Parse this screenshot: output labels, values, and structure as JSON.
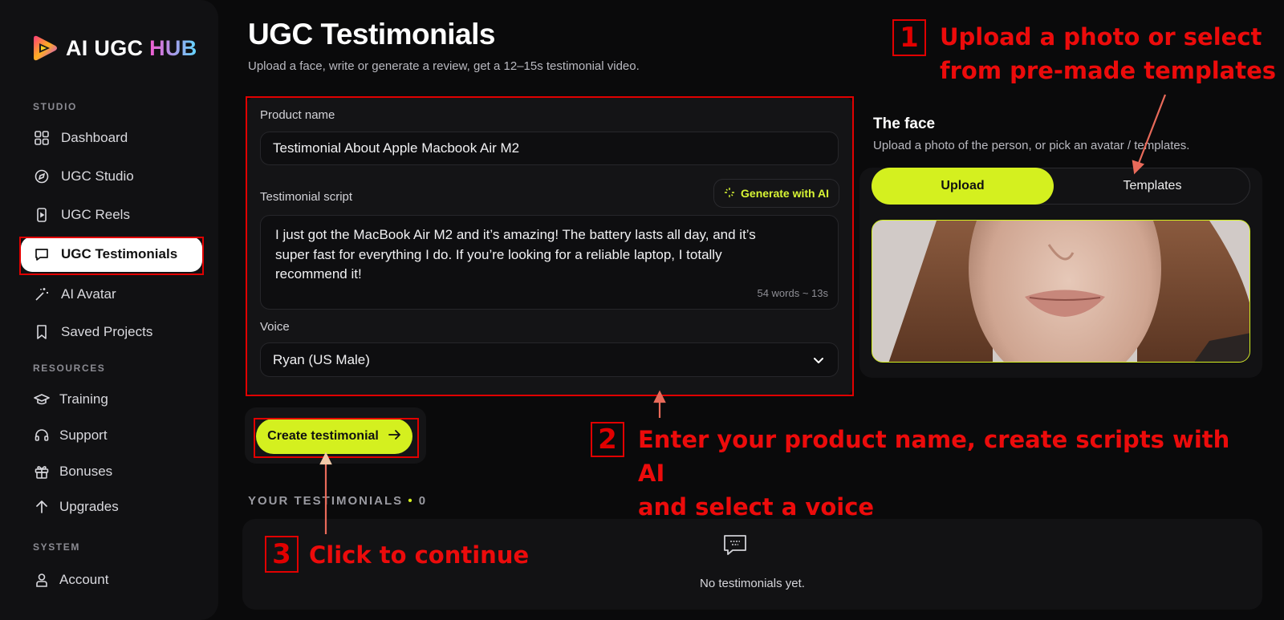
{
  "sidebar": {
    "brand": {
      "part1": "AI UGC ",
      "part2": "HUB"
    },
    "sections": {
      "studio": "STUDIO",
      "resources": "RESOURCES",
      "system": "SYSTEM"
    },
    "items": {
      "dashboard": "Dashboard",
      "ugc_studio": "UGC Studio",
      "ugc_reels": "UGC Reels",
      "ugc_testimonials": "UGC Testimonials",
      "ai_avatar": "AI Avatar",
      "saved_projects": "Saved Projects",
      "training": "Training",
      "support": "Support",
      "bonuses": "Bonuses",
      "upgrades": "Upgrades",
      "account": "Account"
    },
    "active_item": "UGC Testimonials"
  },
  "header": {
    "title": "UGC Testimonials",
    "subtitle": "Upload a face, write or generate a review, get a 12–15s testimonial video."
  },
  "form": {
    "product_label": "Product name",
    "product_value": "Testimonial About Apple Macbook Air M2",
    "script_label": "Testimonial script",
    "generate_label": "Generate with AI",
    "script_value": "I just got the MacBook Air M2 and it’s amazing! The battery lasts all day, and it’s super fast for everything I do. If you’re looking for a reliable laptop, I totally recommend it!",
    "word_count": "54 words ~ 13s",
    "voice_label": "Voice",
    "voice_value": "Ryan (US Male)",
    "create_label": "Create testimonial"
  },
  "face": {
    "title": "The face",
    "subtitle": "Upload a photo of the person, or pick an avatar / templates.",
    "tab_upload": "Upload",
    "tab_templates": "Templates",
    "active_tab": "Upload"
  },
  "testimonials": {
    "title": "YOUR TESTIMONIALS",
    "separator": "•",
    "count": "0",
    "empty_text": "No testimonials yet."
  },
  "annotations": {
    "one": {
      "number": "1",
      "text_line1": "Upload a photo or select",
      "text_line2": "from pre-made templates"
    },
    "two": {
      "number": "2",
      "text_line1": "Enter your product name, create scripts with AI",
      "text_line2": "and select a voice"
    },
    "three": {
      "number": "3",
      "text": "Click to continue"
    }
  },
  "colors": {
    "accent": "#d4f01f",
    "annotation": "#e10000",
    "background": "#0a0a0b"
  },
  "icons": [
    "logo-icon",
    "dashboard-icon",
    "studio-icon",
    "reels-icon",
    "chat-icon",
    "magic-wand-icon",
    "bookmark-icon",
    "graduation-cap-icon",
    "headset-icon",
    "gift-icon",
    "arrow-up-icon",
    "user-icon",
    "sparkle-icon",
    "chevron-down-icon",
    "arrow-right-icon",
    "message-icon"
  ]
}
